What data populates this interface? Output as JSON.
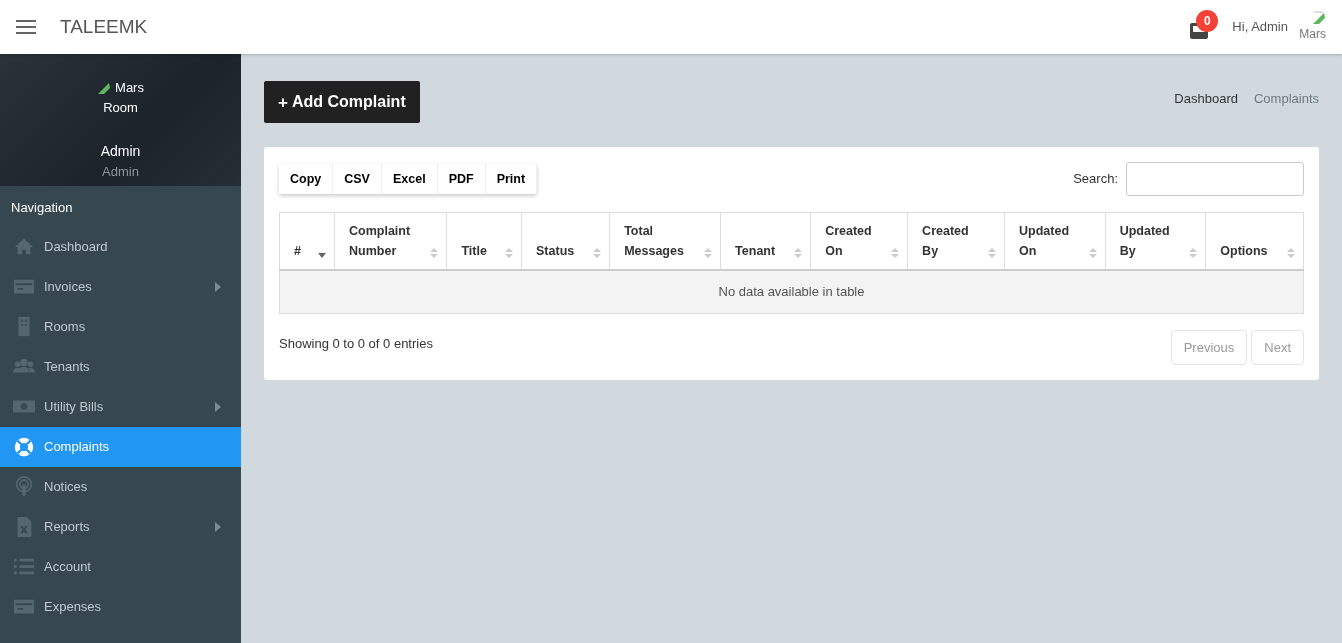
{
  "header": {
    "brand": "TALEEMK",
    "notification_count": "0",
    "greeting": "Hi, Admin",
    "avatar_alt": "Mars"
  },
  "profile": {
    "avatar_alt_lines": [
      "Mars",
      "Room"
    ],
    "name": "Admin",
    "role": "Admin"
  },
  "sidebar": {
    "heading": "Navigation",
    "items": [
      {
        "label": "Dashboard",
        "kind": "home",
        "has_submenu": false,
        "selected": false
      },
      {
        "label": "Invoices",
        "kind": "card",
        "has_submenu": true,
        "selected": false
      },
      {
        "label": "Rooms",
        "kind": "building",
        "has_submenu": false,
        "selected": false
      },
      {
        "label": "Tenants",
        "kind": "users",
        "has_submenu": false,
        "selected": false
      },
      {
        "label": "Utility Bills",
        "kind": "money",
        "has_submenu": true,
        "selected": false
      },
      {
        "label": "Complaints",
        "kind": "lifebuoy",
        "has_submenu": false,
        "selected": true
      },
      {
        "label": "Notices",
        "kind": "podcast",
        "has_submenu": false,
        "selected": false
      },
      {
        "label": "Reports",
        "kind": "excel",
        "has_submenu": true,
        "selected": false
      },
      {
        "label": "Account",
        "kind": "list",
        "has_submenu": false,
        "selected": false
      },
      {
        "label": "Expenses",
        "kind": "card",
        "has_submenu": false,
        "selected": false
      }
    ]
  },
  "add_button": {
    "icon": "+",
    "label": "Add Complaint"
  },
  "breadcrumb": [
    {
      "label": "Dashboard",
      "selected": false
    },
    {
      "label": "Complaints",
      "selected": true
    }
  ],
  "export_buttons": [
    "Copy",
    "CSV",
    "Excel",
    "PDF",
    "Print"
  ],
  "search": {
    "label": "Search:"
  },
  "table": {
    "columns": [
      {
        "lines": [
          "#"
        ],
        "sorted": true
      },
      {
        "lines": [
          "Complaint",
          "Number"
        ],
        "sorted": false
      },
      {
        "lines": [
          "Title"
        ],
        "sorted": false
      },
      {
        "lines": [
          "Status"
        ],
        "sorted": false
      },
      {
        "lines": [
          "Total",
          "Messages"
        ],
        "sorted": false
      },
      {
        "lines": [
          "Tenant"
        ],
        "sorted": false
      },
      {
        "lines": [
          "Created",
          "On"
        ],
        "sorted": false
      },
      {
        "lines": [
          "Created",
          "By"
        ],
        "sorted": false
      },
      {
        "lines": [
          "Updated",
          "On"
        ],
        "sorted": false
      },
      {
        "lines": [
          "Updated",
          "By"
        ],
        "sorted": false
      },
      {
        "lines": [
          "Options"
        ],
        "sorted": false
      }
    ],
    "empty_message": "No data available in table"
  },
  "info": "Showing 0 to 0 of 0 entries",
  "pagination": [
    {
      "label": "Previous",
      "disabled": true
    },
    {
      "label": "Next",
      "disabled": true
    }
  ]
}
